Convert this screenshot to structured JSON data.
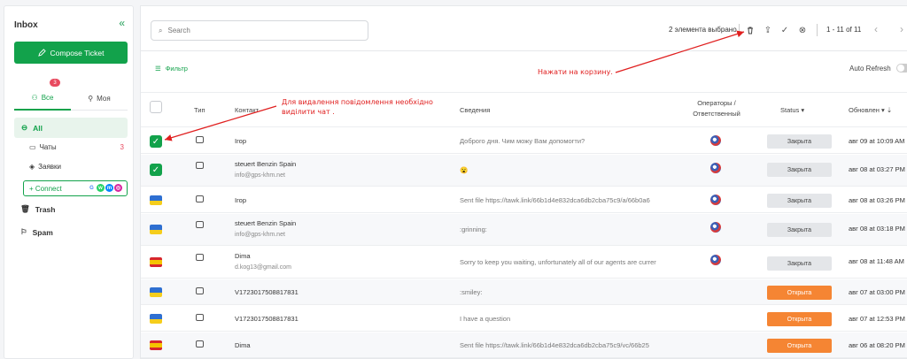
{
  "sidebar": {
    "title": "Inbox",
    "compose_label": "Compose Ticket",
    "tabs": [
      {
        "label": "Все",
        "badge": "3"
      },
      {
        "label": "Моя"
      }
    ],
    "nav_all": "All",
    "chats_label": "Чаты",
    "chats_count": "3",
    "tickets_label": "Заявки",
    "connect_label": "Connect",
    "trash_label": "Trash",
    "spam_label": "Spam"
  },
  "toolbar": {
    "search_placeholder": "Search",
    "selected_text": "2 элемента выбрано",
    "pager_text": "1 - 11 of 11",
    "filter_label": "Фильтр",
    "auto_refresh_label": "Auto Refresh"
  },
  "table": {
    "headers": {
      "type": "Тип",
      "contact": "Контакт",
      "details": "Сведения",
      "operators_line1": "Операторы /",
      "operators_line2": "Ответственный",
      "status": "Status",
      "updated": "Обновлен"
    },
    "rows": [
      {
        "contact": "Ігор",
        "email": "",
        "details": "Доброго дня. Чим можу Вам допомогти?",
        "status": "Закрыта",
        "updated": "авг 09 at 10:09 AM"
      },
      {
        "contact": "steuert Benzin Spain",
        "email": "info@gps-khm.net",
        "details": "😮",
        "status": "Закрыта",
        "updated": "авг 08 at 03:27 PM"
      },
      {
        "contact": "Ігор",
        "email": "",
        "details": "Sent file https://tawk.link/66b1d4e832dca6db2cba75c9/a/66b0a6",
        "status": "Закрыта",
        "updated": "авг 08 at 03:26 PM"
      },
      {
        "contact": "steuert Benzin Spain",
        "email": "info@gps-khm.net",
        "details": ":grinning:",
        "status": "Закрыта",
        "updated": "авг 08 at 03:18 PM"
      },
      {
        "contact": "Dima",
        "email": "d.kog13@gmail.com",
        "details": "Sorry to keep you waiting, unfortunately all of our agents are currer",
        "status": "Закрыта",
        "updated": "авг 08 at 11:48 AM"
      },
      {
        "contact": "V1723017508817831",
        "email": "",
        "details": ":smiley:",
        "status": "Открыта",
        "updated": "авг 07 at 03:00 PM"
      },
      {
        "contact": "V1723017508817831",
        "email": "",
        "details": "I have a question",
        "status": "Открыта",
        "updated": "авг 07 at 12:53 PM"
      },
      {
        "contact": "Dima",
        "email": "",
        "details": "Sent file https://tawk.link/66b1d4e832dca6db2cba75c9/vc/66b25",
        "status": "Открыта",
        "updated": "авг 06 at 08:20 PM"
      }
    ]
  },
  "annotations": {
    "note_select_line1": "Для видалення повідомлення необхідно",
    "note_select_line2": "виділити чат .",
    "note_trash": "Нажати на корзину."
  },
  "colors": {
    "accent": "#12a24b",
    "open": "#f58533",
    "closed": "#e4e6e9",
    "annotation": "#e02020"
  }
}
